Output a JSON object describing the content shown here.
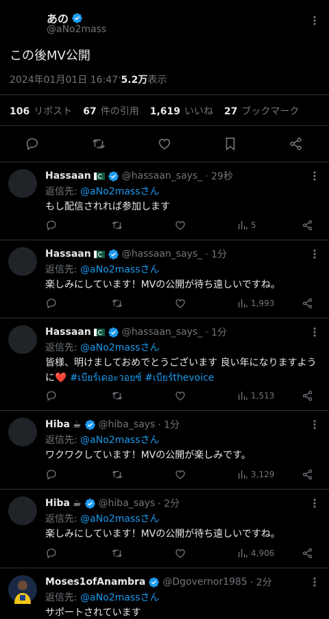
{
  "main": {
    "name": "あの",
    "handle": "@aNo2mass",
    "text": "この後MV公開",
    "time": "2024年01月01日 16:47",
    "sep": " · ",
    "views": "5.2万",
    "views_label": " 表示",
    "stats": {
      "reposts": "106",
      "reposts_label": "リポスト",
      "quotes": "67",
      "quotes_label": "件の引用",
      "likes": "1,619",
      "likes_label": "いいね",
      "bookmarks": "27",
      "bookmarks_label": "ブックマーク"
    }
  },
  "reply_prefix": "返信先:",
  "reply_target": "@aNo2massさん",
  "replies": [
    {
      "name": "Hassaan",
      "emoji": "flag",
      "handle": "@hassaan_says_",
      "time": "· 29秒",
      "text": "もし配信されれば参加します",
      "hashtags": "",
      "views": "5"
    },
    {
      "name": "Hassaan",
      "emoji": "flag",
      "handle": "@hassaan_says_",
      "time": "· 1分",
      "text": "楽しみにしています！MVの公開が待ち遠しいですね。",
      "hashtags": "",
      "views": "1,993"
    },
    {
      "name": "Hassaan",
      "emoji": "flag",
      "handle": "@hassaan_says_",
      "time": "· 1分",
      "text": "皆様、明けましておめでとうございます 良い年になりますように❤️ ",
      "hashtags": "#เบียร์เดอะวอยซ์ #เบียร์thevoice",
      "views": "1,513"
    },
    {
      "name": "Hiba",
      "emoji": "☕",
      "handle": "@hiba_says",
      "time": "· 1分",
      "text": "ワクワクしています！MVの公開が楽しみです。",
      "hashtags": "",
      "views": "3,129"
    },
    {
      "name": "Hiba",
      "emoji": "☕",
      "handle": "@hiba_says",
      "time": "· 2分",
      "text": "楽しみにしています！MVの公開が待ち遠しいですね。",
      "hashtags": "",
      "views": "4,906"
    },
    {
      "name": "Moses1ofAnambra",
      "emoji": "",
      "handle": "@Dgovernor1985",
      "time": "· 2分",
      "text": "サポートされています",
      "hashtags": "",
      "views": ""
    }
  ],
  "colors": {
    "background": "#000000",
    "text": "#e7e9ea",
    "muted": "#71767b",
    "accent": "#1d9bf0",
    "divider": "#2f3336"
  },
  "icons": [
    "verified-badge-icon",
    "more-icon",
    "reply-icon",
    "repost-icon",
    "like-icon",
    "bookmark-icon",
    "share-icon",
    "views-icon",
    "pakistan-flag-icon",
    "coffee-icon"
  ]
}
